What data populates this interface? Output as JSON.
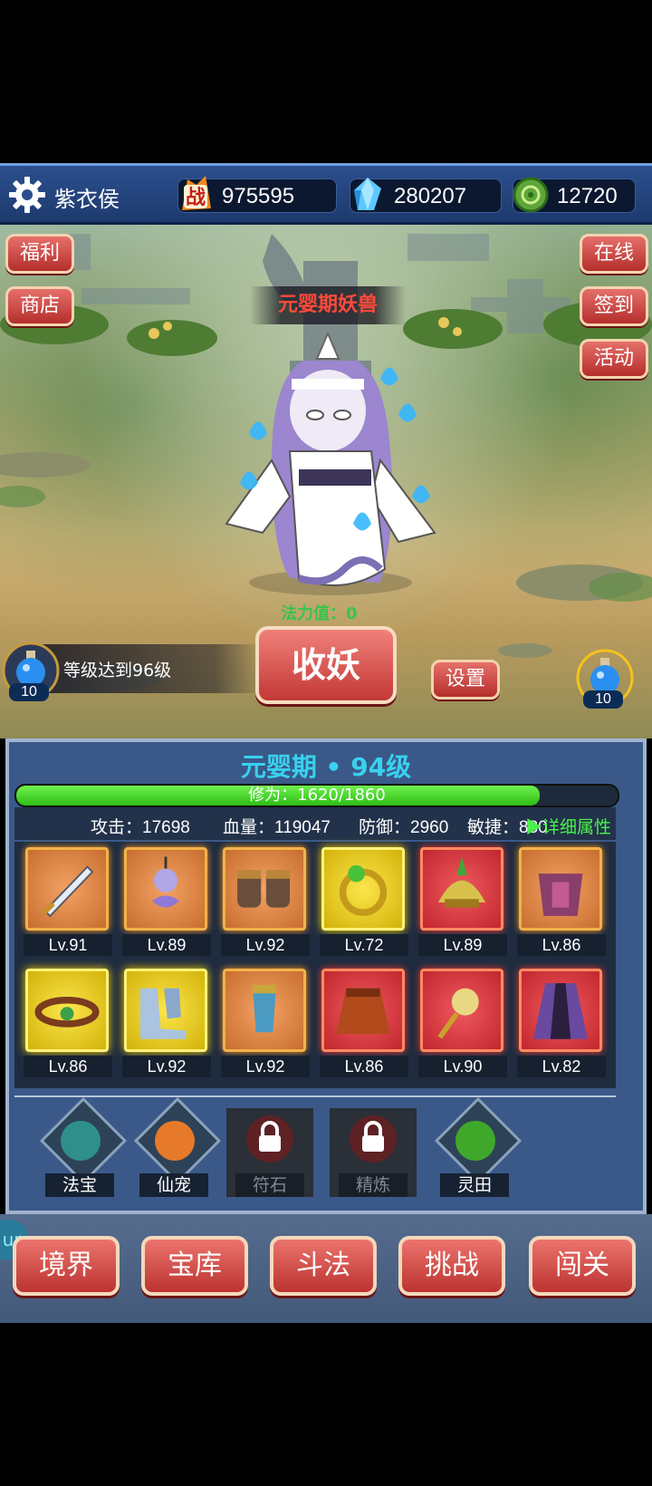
{
  "header": {
    "player_name": "紫衣侯",
    "combat_power": "975595",
    "combat_icon_label": "战",
    "gems": "280207",
    "jade": "12720"
  },
  "left_buttons": [
    "福利",
    "商店"
  ],
  "right_buttons": [
    "在线",
    "签到",
    "活动"
  ],
  "battle": {
    "enemy_title": "元婴期妖兽",
    "power_label": "法力值：0",
    "capture_label": "收妖",
    "settings_label": "设置",
    "level_task": "等级达到96级",
    "left_potion_count": "10",
    "right_potion_count": "10"
  },
  "character": {
    "realm": "元婴期 • 94级",
    "cultivation_text": "修为：1620/1860",
    "cultivation_fraction": 0.871,
    "stats": {
      "attack": "攻击：17698",
      "hp": "血量：119047",
      "defense": "防御：2960",
      "agility": "敏捷：880",
      "detail": "▶详细属性"
    },
    "equipment": [
      {
        "name": "sword",
        "level": "Lv.91",
        "quality": "orange"
      },
      {
        "name": "pendant",
        "level": "Lv.89",
        "quality": "orange"
      },
      {
        "name": "gauntlets",
        "level": "Lv.92",
        "quality": "orange"
      },
      {
        "name": "ring",
        "level": "Lv.72",
        "quality": "gold"
      },
      {
        "name": "helmet",
        "level": "Lv.89",
        "quality": "red"
      },
      {
        "name": "armor",
        "level": "Lv.86",
        "quality": "orange"
      },
      {
        "name": "belt",
        "level": "Lv.86",
        "quality": "gold"
      },
      {
        "name": "boots",
        "level": "Lv.92",
        "quality": "gold"
      },
      {
        "name": "bracer",
        "level": "Lv.92",
        "quality": "orange"
      },
      {
        "name": "skirt",
        "level": "Lv.86",
        "quality": "red"
      },
      {
        "name": "amulet",
        "level": "Lv.90",
        "quality": "red"
      },
      {
        "name": "cloak",
        "level": "Lv.82",
        "quality": "red"
      }
    ],
    "functions": [
      {
        "label": "法宝",
        "locked": false
      },
      {
        "label": "仙宠",
        "locked": false
      },
      {
        "label": "符石",
        "locked": true
      },
      {
        "label": "精炼",
        "locked": true
      },
      {
        "label": "灵田",
        "locked": false
      }
    ]
  },
  "nav": [
    "境界",
    "宝库",
    "斗法",
    "挑战",
    "闯关"
  ],
  "side_tag": "up",
  "colors": {
    "red_button": "#c33835",
    "panel_blue": "#3a5989",
    "xp_green": "#3fd024",
    "realm_cyan": "#39d1ef",
    "enemy_title_red": "#ff4a3a"
  }
}
